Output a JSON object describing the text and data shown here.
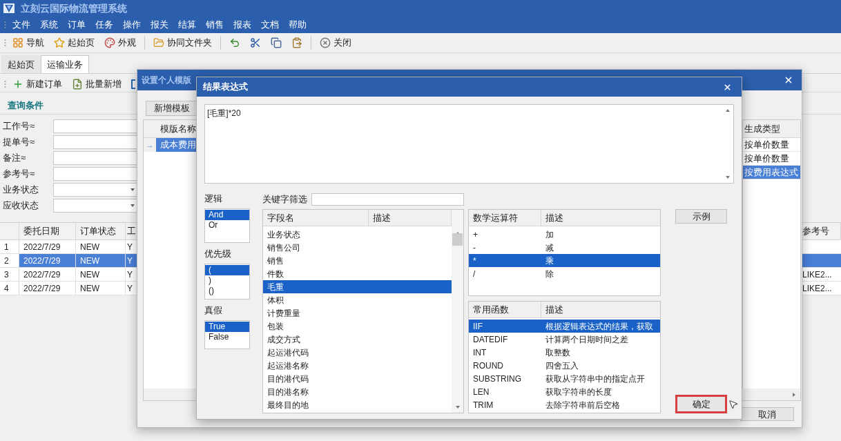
{
  "app": {
    "title": "立刻云国际物流管理系统"
  },
  "menu": [
    "文件",
    "系统",
    "订单",
    "任务",
    "操作",
    "报关",
    "结算",
    "销售",
    "报表",
    "文档",
    "帮助"
  ],
  "toolbar": [
    {
      "kind": "nav",
      "label": "导航"
    },
    {
      "kind": "star",
      "label": "起始页"
    },
    {
      "kind": "palette",
      "label": "外观"
    },
    {
      "kind": "separator"
    },
    {
      "kind": "folder",
      "label": "协同文件夹"
    },
    {
      "kind": "separator"
    },
    {
      "kind": "undo"
    },
    {
      "kind": "cut"
    },
    {
      "kind": "copy"
    },
    {
      "kind": "paste"
    },
    {
      "kind": "separator"
    },
    {
      "kind": "close",
      "label": "关闭"
    }
  ],
  "tabs": [
    {
      "label": "起始页",
      "selected": false
    },
    {
      "label": "运输业务",
      "selected": true
    }
  ],
  "sub_toolbar": [
    {
      "kind": "add",
      "label": "新建订单"
    },
    {
      "kind": "batch",
      "label": "批量新增"
    },
    {
      "kind": "form"
    }
  ],
  "query": {
    "title": "查询条件",
    "fields": [
      {
        "label": "工作号≈",
        "kind": "text"
      },
      {
        "label": "提单号≈",
        "kind": "text"
      },
      {
        "label": "备注≈",
        "kind": "text"
      },
      {
        "label": "参考号≈",
        "kind": "text"
      },
      {
        "label": "业务状态",
        "kind": "select"
      },
      {
        "label": "应收状态",
        "kind": "select"
      }
    ]
  },
  "grid": {
    "columns": [
      "委托日期",
      "订单状态",
      "工",
      "参考号"
    ],
    "rows": [
      {
        "number": "1",
        "cells": [
          "2022/7/29",
          "NEW",
          "Y"
        ],
        "selected": false
      },
      {
        "number": "2",
        "cells": [
          "2022/7/29",
          "NEW",
          "Y"
        ],
        "selected": true
      },
      {
        "number": "3",
        "cells": [
          "2022/7/29",
          "NEW",
          "Y"
        ],
        "reference": "LIKE2...",
        "selected": false
      },
      {
        "number": "4",
        "cells": [
          "2022/7/29",
          "NEW",
          "Y"
        ],
        "reference": "LIKE2...",
        "selected": false
      }
    ]
  },
  "template_dialog": {
    "title": "设置个人模版",
    "add_button": "新增模板",
    "name_column": "模版名称",
    "names": [
      {
        "indicator": "→",
        "text": "成本费用",
        "selected": true
      }
    ],
    "type_column": "生成类型",
    "types": [
      {
        "text": "按单价数量",
        "selected": false
      },
      {
        "text": "按单价数量",
        "selected": false
      },
      {
        "text": "按费用表达式",
        "selected": true
      }
    ],
    "cancel_button": "取消"
  },
  "expression_dialog": {
    "title": "结果表达式",
    "expression": "[毛重]*20",
    "groups": [
      {
        "label": "逻辑",
        "options": [
          {
            "text": "And",
            "selected": true
          },
          {
            "text": "Or",
            "selected": false
          }
        ]
      },
      {
        "label": "优先级",
        "options": [
          {
            "text": "(",
            "selected": true
          },
          {
            "text": ")",
            "selected": false
          },
          {
            "text": "()",
            "selected": false
          }
        ]
      },
      {
        "label": "真假",
        "options": [
          {
            "text": "True",
            "selected": true
          },
          {
            "text": "False",
            "selected": false
          }
        ]
      }
    ],
    "filter_label": "关键字筛选",
    "fields": {
      "columns": [
        "字段名",
        "描述"
      ],
      "rows": [
        {
          "name": "业务状态",
          "selected": false
        },
        {
          "name": "销售公司",
          "selected": false
        },
        {
          "name": "销售",
          "selected": false
        },
        {
          "name": "件数",
          "selected": false
        },
        {
          "name": "毛重",
          "selected": true
        },
        {
          "name": "体积",
          "selected": false
        },
        {
          "name": "计费重量",
          "selected": false
        },
        {
          "name": "包装",
          "selected": false
        },
        {
          "name": "成交方式",
          "selected": false
        },
        {
          "name": "起运港代码",
          "selected": false
        },
        {
          "name": "起运港名称",
          "selected": false
        },
        {
          "name": "目的港代码",
          "selected": false
        },
        {
          "name": "目的港名称",
          "selected": false
        },
        {
          "name": "最终目的地",
          "selected": false
        }
      ]
    },
    "operators": {
      "columns": [
        "数学运算符",
        "描述"
      ],
      "rows": [
        {
          "symbol": "+",
          "description": "加",
          "selected": false
        },
        {
          "symbol": "-",
          "description": "减",
          "selected": false
        },
        {
          "symbol": "*",
          "description": "乘",
          "selected": true
        },
        {
          "symbol": "/",
          "description": "除",
          "selected": false
        }
      ]
    },
    "functions": {
      "columns": [
        "常用函数",
        "描述"
      ],
      "rows": [
        {
          "symbol": "IIF",
          "description": "根据逻辑表达式的结果，获取",
          "selected": true
        },
        {
          "symbol": "DATEDIF",
          "description": "计算两个日期时间之差",
          "selected": false
        },
        {
          "symbol": "INT",
          "description": "取整数",
          "selected": false
        },
        {
          "symbol": "ROUND",
          "description": "四舍五入",
          "selected": false
        },
        {
          "symbol": "SUBSTRING",
          "description": "获取从字符串中的指定点开",
          "selected": false
        },
        {
          "symbol": "LEN",
          "description": "获取字符串的长度",
          "selected": false
        },
        {
          "symbol": "TRIM",
          "description": "去除字符串前后空格",
          "selected": false
        }
      ]
    },
    "example_button": "示例",
    "ok_button": {
      "label": "确定",
      "highlighted": true
    }
  }
}
